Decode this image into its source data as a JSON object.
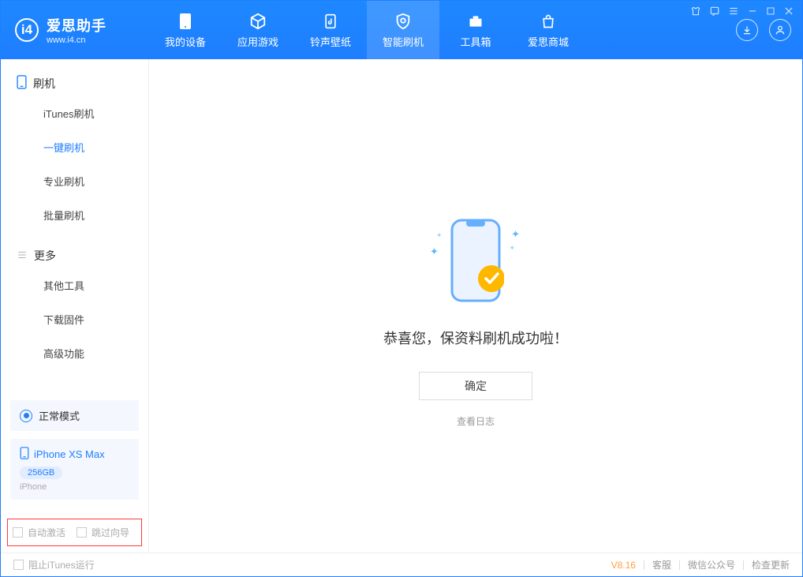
{
  "app": {
    "name": "爱思助手",
    "url": "www.i4.cn"
  },
  "nav": {
    "tabs": [
      {
        "label": "我的设备"
      },
      {
        "label": "应用游戏"
      },
      {
        "label": "铃声壁纸"
      },
      {
        "label": "智能刷机"
      },
      {
        "label": "工具箱"
      },
      {
        "label": "爱思商城"
      }
    ],
    "active_index": 3
  },
  "sidebar": {
    "group1": {
      "title": "刷机",
      "items": [
        "iTunes刷机",
        "一键刷机",
        "专业刷机",
        "批量刷机"
      ],
      "active_index": 1
    },
    "group2": {
      "title": "更多",
      "items": [
        "其他工具",
        "下载固件",
        "高级功能"
      ]
    },
    "mode": {
      "label": "正常模式"
    },
    "device": {
      "name": "iPhone XS Max",
      "storage": "256GB",
      "type": "iPhone"
    },
    "checks": {
      "auto_activate": "自动激活",
      "skip_guide": "跳过向导"
    }
  },
  "main": {
    "message": "恭喜您，保资料刷机成功啦！",
    "ok": "确定",
    "view_log": "查看日志"
  },
  "footer": {
    "block_itunes": "阻止iTunes运行",
    "version": "V8.16",
    "links": [
      "客服",
      "微信公众号",
      "检查更新"
    ]
  }
}
